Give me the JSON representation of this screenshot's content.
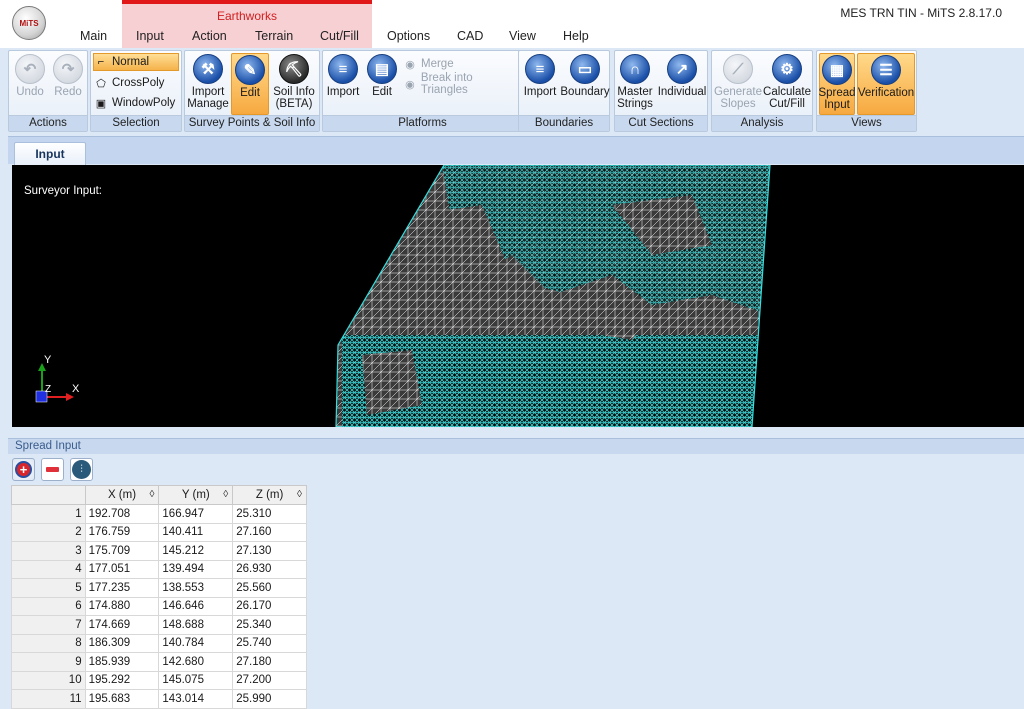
{
  "window": {
    "title": "MES TRN TIN - MiTS 2.8.17.0",
    "logo_text": "MiTS"
  },
  "context_group": {
    "label": "Earthworks"
  },
  "tabs": [
    {
      "label": "Main"
    },
    {
      "label": "Input"
    },
    {
      "label": "Action"
    },
    {
      "label": "Terrain"
    },
    {
      "label": "Cut/Fill"
    },
    {
      "label": "Options"
    },
    {
      "label": "CAD"
    },
    {
      "label": "View"
    },
    {
      "label": "Help"
    }
  ],
  "ribbon": {
    "actions": {
      "label": "Actions",
      "undo": "Undo",
      "redo": "Redo"
    },
    "selection": {
      "label": "Selection",
      "normal": "Normal",
      "crosspoly": "CrossPoly",
      "windowpoly": "WindowPoly"
    },
    "survey": {
      "label": "Survey Points & Soil Info",
      "import_manage_1": "Import",
      "import_manage_2": "Manage",
      "edit": "Edit",
      "soil_1": "Soil Info",
      "soil_2": "(BETA)"
    },
    "platforms": {
      "label": "Platforms",
      "import": "Import",
      "edit": "Edit",
      "merge": "Merge",
      "break": "Break into Triangles"
    },
    "boundaries": {
      "label": "Boundaries",
      "import": "Import",
      "boundary": "Boundary"
    },
    "cut_sections": {
      "label": "Cut Sections",
      "master_1": "Master",
      "master_2": "Strings",
      "individual": "Individual"
    },
    "analysis": {
      "label": "Analysis",
      "gen_1": "Generate",
      "gen_2": "Slopes",
      "calc_1": "Calculate",
      "calc_2": "Cut/Fill"
    },
    "views": {
      "label": "Views",
      "spread_1": "Spread",
      "spread_2": "Input",
      "verification": "Verification"
    }
  },
  "document_tab": {
    "label": "Input"
  },
  "viewport": {
    "label": "Surveyor Input:",
    "axis_y": "Y",
    "axis_x": "X",
    "axis_z": "Z",
    "mesh_color": "#33e0e0",
    "background": "#000000"
  },
  "spread_panel": {
    "title": "Spread Input",
    "columns": [
      "X (m)",
      "Y (m)",
      "Z (m)"
    ],
    "rows": [
      [
        "1",
        "192.708",
        "166.947",
        "25.310"
      ],
      [
        "2",
        "176.759",
        "140.411",
        "27.160"
      ],
      [
        "3",
        "175.709",
        "145.212",
        "27.130"
      ],
      [
        "4",
        "177.051",
        "139.494",
        "26.930"
      ],
      [
        "5",
        "177.235",
        "138.553",
        "25.560"
      ],
      [
        "6",
        "174.880",
        "146.646",
        "26.170"
      ],
      [
        "7",
        "174.669",
        "148.688",
        "25.340"
      ],
      [
        "8",
        "186.309",
        "140.784",
        "25.740"
      ],
      [
        "9",
        "185.939",
        "142.680",
        "27.180"
      ],
      [
        "10",
        "195.292",
        "145.075",
        "27.200"
      ],
      [
        "11",
        "195.683",
        "143.014",
        "25.990"
      ]
    ]
  }
}
